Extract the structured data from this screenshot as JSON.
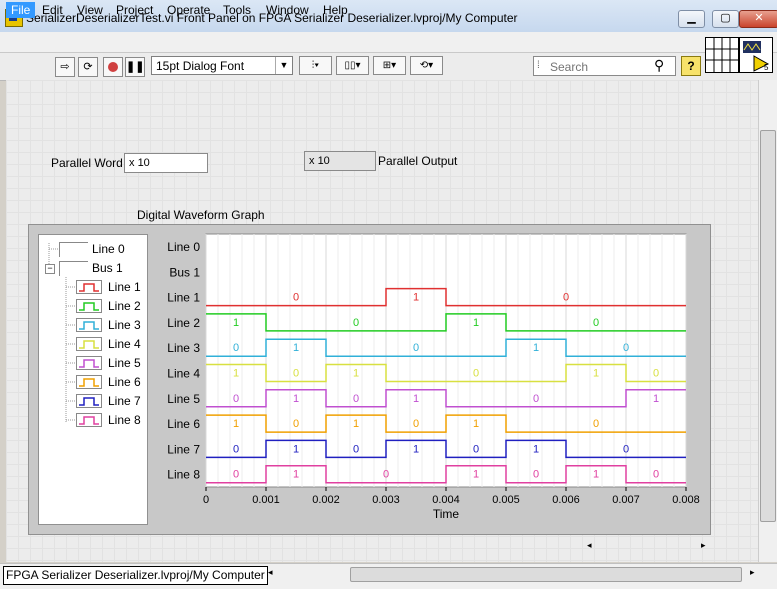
{
  "window": {
    "title": "SerializerDeserializerTest.vi Front Panel on FPGA Serializer Deserializer.lvproj/My Computer"
  },
  "menu": [
    "File",
    "Edit",
    "View",
    "Project",
    "Operate",
    "Tools",
    "Window",
    "Help"
  ],
  "toolbar": {
    "font": "15pt Dialog Font",
    "search_placeholder": "Search",
    "help": "?"
  },
  "controls": {
    "parallel_word": {
      "label": "Parallel Word",
      "radix": "x",
      "value": "10"
    },
    "parallel_output": {
      "label": "Parallel Output",
      "radix": "x",
      "value": "10"
    }
  },
  "graph": {
    "label": "Digital Waveform Graph",
    "xlabel": "Time"
  },
  "tree": {
    "line0": "Line 0",
    "bus": "Bus 1",
    "collapse_symbol": "−",
    "lines": [
      {
        "label": "Line 1",
        "color": "#e03030"
      },
      {
        "label": "Line 2",
        "color": "#22cc22"
      },
      {
        "label": "Line 3",
        "color": "#30b0d8"
      },
      {
        "label": "Line 4",
        "color": "#d8e040"
      },
      {
        "label": "Line 5",
        "color": "#c050d0"
      },
      {
        "label": "Line 6",
        "color": "#f0a000"
      },
      {
        "label": "Line 7",
        "color": "#2020c0"
      },
      {
        "label": "Line 8",
        "color": "#e040a0"
      }
    ]
  },
  "chart_data": {
    "type": "digital-waveform",
    "x_ticks": [
      "0",
      "0.001",
      "0.002",
      "0.003",
      "0.004",
      "0.005",
      "0.006",
      "0.007",
      "0.008"
    ],
    "xlim": [
      0,
      0.008
    ],
    "row_labels": [
      "Line 0",
      "Bus 1",
      "Line 1",
      "Line 2",
      "Line 3",
      "Line 4",
      "Line 5",
      "Line 6",
      "Line 7",
      "Line 8"
    ],
    "segments": [
      {
        "start": 0,
        "end": 0.001
      },
      {
        "start": 0.001,
        "end": 0.002
      },
      {
        "start": 0.002,
        "end": 0.003
      },
      {
        "start": 0.003,
        "end": 0.004
      },
      {
        "start": 0.004,
        "end": 0.005
      },
      {
        "start": 0.005,
        "end": 0.006
      },
      {
        "start": 0.006,
        "end": 0.007
      },
      {
        "start": 0.007,
        "end": 0.008
      }
    ],
    "series": [
      {
        "name": "Line 1",
        "color": "#e03030",
        "bits": [
          0,
          0,
          0,
          1,
          0,
          0,
          0,
          0
        ]
      },
      {
        "name": "Line 2",
        "color": "#22cc22",
        "bits": [
          1,
          0,
          0,
          0,
          1,
          0,
          0,
          0
        ]
      },
      {
        "name": "Line 3",
        "color": "#30b0d8",
        "bits": [
          0,
          1,
          0,
          0,
          0,
          1,
          0,
          0
        ]
      },
      {
        "name": "Line 4",
        "color": "#d8e040",
        "bits": [
          1,
          0,
          1,
          0,
          0,
          0,
          1,
          0
        ]
      },
      {
        "name": "Line 5",
        "color": "#c050d0",
        "bits": [
          0,
          1,
          0,
          1,
          0,
          0,
          0,
          1
        ]
      },
      {
        "name": "Line 6",
        "color": "#f0a000",
        "bits": [
          1,
          0,
          1,
          0,
          1,
          0,
          0,
          0
        ]
      },
      {
        "name": "Line 7",
        "color": "#2020c0",
        "bits": [
          0,
          1,
          0,
          1,
          0,
          1,
          0,
          0
        ]
      },
      {
        "name": "Line 8",
        "color": "#e040a0",
        "bits": [
          0,
          1,
          0,
          0,
          1,
          0,
          1,
          0
        ]
      }
    ]
  },
  "status": {
    "text": "FPGA Serializer Deserializer.lvproj/My Computer"
  }
}
